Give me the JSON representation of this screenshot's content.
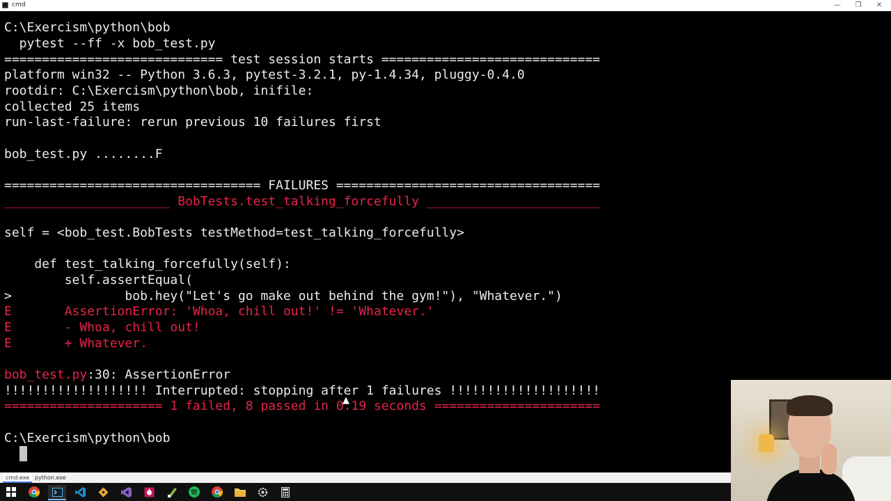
{
  "window": {
    "title": "cmd",
    "minimize_icon": "minimize-icon",
    "restore_icon": "restore-icon",
    "close_icon": "close-icon"
  },
  "terminal": {
    "prompt1": "C:\\Exercism\\python\\bob",
    "command": "  pytest --ff -x bob_test.py",
    "session_start": "============================= test session starts =============================",
    "platform": "platform win32 -- Python 3.6.3, pytest-3.2.1, py-1.4.34, pluggy-0.4.0",
    "rootdir": "rootdir: C:\\Exercism\\python\\bob, inifile:",
    "collected": "collected 25 items",
    "run_last_failure": "run-last-failure: rerun previous 10 failures first",
    "progress": "bob_test.py ........F",
    "failures_header": "================================== FAILURES ===================================",
    "failure_test": "______________________ BobTests.test_talking_forcefully _______________________",
    "self_line": "self = <bob_test.BobTests testMethod=test_talking_forcefully>",
    "code_def": "    def test_talking_forcefully(self):",
    "code_assert": "        self.assertEqual(",
    "code_call": ">               bob.hey(\"Let's go make out behind the gym!\"), \"Whatever.\")",
    "err1": "E       AssertionError: 'Whoa, chill out!' != 'Whatever.'",
    "err2": "E       - Whoa, chill out!",
    "err3": "E       + Whatever.",
    "location_file": "bob_test.py",
    "location_rest": ":30: AssertionError",
    "interrupted": "!!!!!!!!!!!!!!!!!!! Interrupted: stopping after 1 failures !!!!!!!!!!!!!!!!!!!!",
    "summary": "===================== 1 failed, 8 passed in 0.19 seconds ======================",
    "prompt2": "C:\\Exercism\\python\\bob"
  },
  "tabs": [
    {
      "label": "cmd.exe"
    },
    {
      "label": "python.exe"
    }
  ],
  "taskbar": {
    "icons": [
      "windows-start-icon",
      "chrome-icon",
      "console-icon",
      "vscode-icon",
      "git-icon",
      "visual-studio-icon",
      "bug-tracker-icon",
      "notepad-plus-icon",
      "spotify-icon",
      "chrome-icon",
      "file-explorer-icon",
      "settings-icon",
      "calculator-icon"
    ]
  },
  "colors": {
    "background": "#000000",
    "text": "#ececec",
    "error": "#e8234b"
  }
}
